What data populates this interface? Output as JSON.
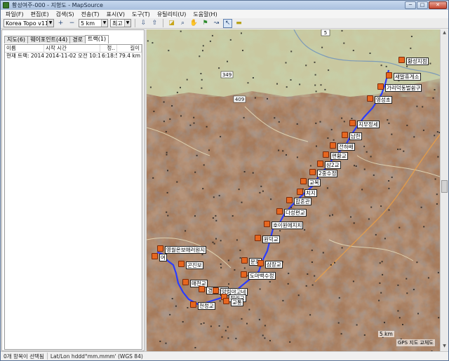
{
  "window": {
    "title": "황성여주-000 - 지형도 - MapSource",
    "controls": [
      "─",
      "□",
      "✕"
    ]
  },
  "menu": [
    "파일(F)",
    "편집(E)",
    "검색(S)",
    "전송(T)",
    "표시(V)",
    "도구(T)",
    "유틸리티(U)",
    "도움말(H)"
  ],
  "toolbar": {
    "map_product": "Korea Topo v11",
    "scale": "5 km",
    "detail": "최고",
    "zoom_in": "+",
    "zoom_out": "−"
  },
  "tabs": [
    "지도(6)",
    "웨이포인트(44)",
    "경로",
    "트랙(1)"
  ],
  "track_table": {
    "headers": [
      "이름",
      "시작 시간",
      "정..",
      "길이"
    ],
    "rows": [
      [
        "현재 트랙: 2014...",
        "2014-11-02 오전 10:19:...",
        "6:18:55",
        "79.4 km"
      ]
    ]
  },
  "map": {
    "road_markers": [
      "5",
      "349",
      "409"
    ],
    "waypoints": [
      "황성지점",
      "새말휴게소",
      "가리덕동벌쉼구",
      "영성초",
      "지무정세",
      "남한",
      "전하배",
      "편황교",
      "삼2교",
      "2중수정",
      "교목",
      "치지",
      "합혼관",
      "다성편교",
      "호이원에지치",
      "원덕교",
      "영월온보애러원지",
      "여",
      "곤진보",
      "매천교",
      "경희상가",
      "천정교",
      "앙림야고네",
      "장리교",
      "도마백수정",
      "교통",
      "문화",
      "삼장교"
    ],
    "scale_label": "5 km",
    "credit": "GPS 지도 교체도"
  },
  "status": {
    "selection": "0개 항목이 선택됨",
    "coord_format": "Lat/Lon hddd°mm.mmm' (WGS 84)"
  },
  "colors": {
    "track": "#2b3cff",
    "waypoint_icon": "#e6661f",
    "terrain": "#a5785a"
  }
}
